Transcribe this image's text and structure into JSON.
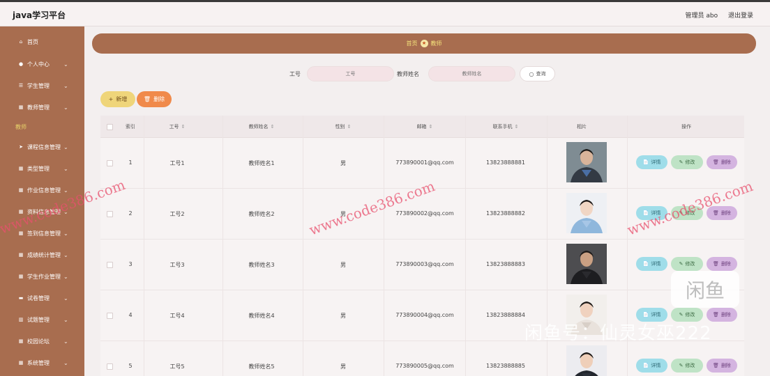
{
  "header": {
    "brand": "java学习平台",
    "user_label": "管理员 abo",
    "logout_label": "退出登录"
  },
  "sidebar": {
    "items": [
      {
        "label": "首页",
        "icon": "home-icon",
        "glyph": "⌂",
        "has_chevron": false
      },
      {
        "label": "个人中心",
        "icon": "user-icon",
        "glyph": "●",
        "has_chevron": true
      },
      {
        "label": "学生管理",
        "icon": "list-icon",
        "glyph": "☰",
        "has_chevron": true
      },
      {
        "label": "教师管理",
        "icon": "grid-icon",
        "glyph": "▦",
        "has_chevron": true
      },
      {
        "label": "课程信息管理",
        "icon": "send-icon",
        "glyph": "➤",
        "has_chevron": true
      },
      {
        "label": "类型管理",
        "icon": "grid-icon",
        "glyph": "▦",
        "has_chevron": true
      },
      {
        "label": "作业信息管理",
        "icon": "grid-icon",
        "glyph": "▦",
        "has_chevron": true
      },
      {
        "label": "资料信息管理",
        "icon": "grid-icon",
        "glyph": "▦",
        "has_chevron": true
      },
      {
        "label": "签到信息管理",
        "icon": "grid-icon",
        "glyph": "▦",
        "has_chevron": true
      },
      {
        "label": "成绩统计管理",
        "icon": "grid-icon",
        "glyph": "▦",
        "has_chevron": true
      },
      {
        "label": "学生作业管理",
        "icon": "grid-icon",
        "glyph": "▦",
        "has_chevron": true
      },
      {
        "label": "试卷管理",
        "icon": "doc-icon",
        "glyph": "▬",
        "has_chevron": true
      },
      {
        "label": "试题管理",
        "icon": "chart-icon",
        "glyph": "▥",
        "has_chevron": true
      },
      {
        "label": "校园论坛",
        "icon": "grid-icon",
        "glyph": "▦",
        "has_chevron": true
      },
      {
        "label": "系统管理",
        "icon": "grid-icon",
        "glyph": "▦",
        "has_chevron": true
      }
    ],
    "sub_label": "教师"
  },
  "breadcrumb": {
    "home": "首页",
    "current": "教师"
  },
  "search": {
    "field1_label": "工号",
    "field1_placeholder": "工号",
    "field2_label": "教师姓名",
    "field2_placeholder": "教师姓名",
    "button_label": "查询"
  },
  "actions": {
    "add_label": "新增",
    "delete_label": "删除"
  },
  "table": {
    "headers": [
      "索引",
      "工号",
      "教师姓名",
      "性别",
      "邮箱",
      "联系手机",
      "相片",
      "操作"
    ],
    "rows": [
      {
        "index": "1",
        "id": "工号1",
        "name": "教师姓名1",
        "gender": "男",
        "email": "773890001@qq.com",
        "phone": "13823888881"
      },
      {
        "index": "2",
        "id": "工号2",
        "name": "教师姓名2",
        "gender": "男",
        "email": "773890002@qq.com",
        "phone": "13823888882"
      },
      {
        "index": "3",
        "id": "工号3",
        "name": "教师姓名3",
        "gender": "男",
        "email": "773890003@qq.com",
        "phone": "13823888883"
      },
      {
        "index": "4",
        "id": "工号4",
        "name": "教师姓名4",
        "gender": "男",
        "email": "773890004@qq.com",
        "phone": "13823888884"
      },
      {
        "index": "5",
        "id": "工号5",
        "name": "教师姓名5",
        "gender": "男",
        "email": "773890005@qq.com",
        "phone": "13823888885"
      }
    ],
    "op_detail": "详情",
    "op_edit": "修改",
    "op_delete": "删除"
  },
  "watermarks": {
    "code386": "www.code386.com",
    "xianyu": "闲鱼号：仙灵女巫222",
    "xianyu_logo": "闲鱼"
  }
}
